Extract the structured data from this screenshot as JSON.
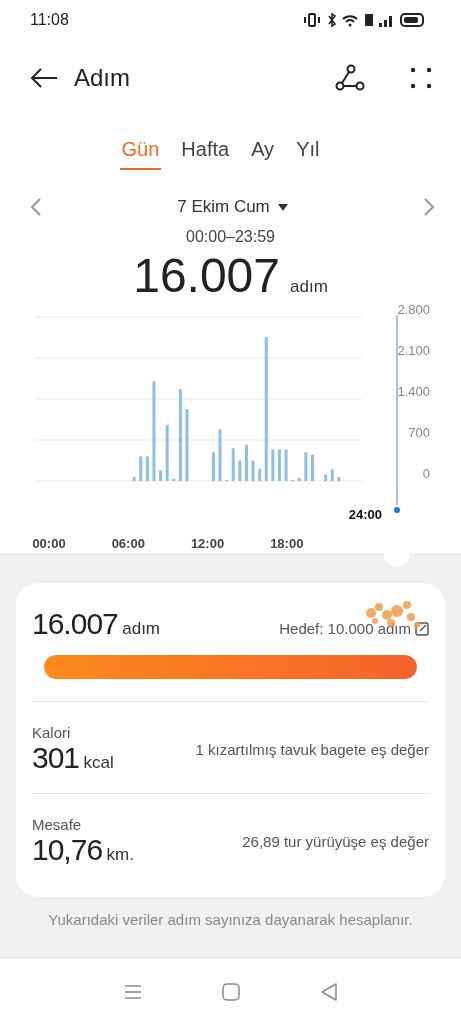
{
  "status_bar": {
    "time": "11:08"
  },
  "header": {
    "title": "Adım"
  },
  "tabs": [
    {
      "label": "Gün",
      "selected": true
    },
    {
      "label": "Hafta",
      "selected": false
    },
    {
      "label": "Ay",
      "selected": false
    },
    {
      "label": "Yıl",
      "selected": false
    }
  ],
  "date_nav": {
    "date": "7 Ekim Cum",
    "range": "00:00–23:59"
  },
  "total": {
    "value": "16.007",
    "unit": "adım"
  },
  "chart": {
    "cursor_label": "24:00",
    "chart_data": {
      "type": "bar",
      "xlim": [
        0,
        24
      ],
      "ylim": [
        0,
        2800
      ],
      "grid": true,
      "x": [
        6.75,
        7.25,
        7.75,
        8.25,
        8.75,
        9.25,
        9.75,
        10.25,
        10.75,
        12.75,
        13.25,
        13.75,
        14.25,
        14.75,
        15.25,
        15.75,
        16.25,
        16.75,
        17.25,
        17.75,
        18.25,
        18.75,
        19.25,
        19.75,
        20.25,
        21.25,
        21.75,
        22.25
      ],
      "xticks": [
        {
          "value": 0,
          "label": "00:00"
        },
        {
          "value": 6,
          "label": "06:00"
        },
        {
          "value": 12,
          "label": "12:00"
        },
        {
          "value": 18,
          "label": "18:00"
        }
      ],
      "yticks": [
        {
          "value": 0,
          "label": "0"
        },
        {
          "value": 700,
          "label": "700"
        },
        {
          "value": 1400,
          "label": "1.400"
        },
        {
          "value": 2100,
          "label": "2.100"
        },
        {
          "value": 2800,
          "label": "2.800"
        }
      ],
      "series": [
        {
          "color": "#8cbfe8",
          "values": [
            70,
            420,
            420,
            1700,
            180,
            960,
            40,
            1570,
            1230,
            490,
            880,
            20,
            560,
            350,
            620,
            350,
            210,
            2460,
            540,
            540,
            540,
            20,
            50,
            490,
            450,
            110,
            200,
            70
          ]
        }
      ]
    }
  },
  "summary": {
    "steps": {
      "value": "16.007",
      "unit": "adım"
    },
    "goal": "Hedef: 10.000 adım",
    "level": 1,
    "rows": [
      {
        "label": "Kalori",
        "value": "301",
        "unit": "kcal",
        "note": "1 kızartılmış tavuk bagete eş değer"
      },
      {
        "label": "Mesafe",
        "value": "10,76",
        "unit": "km.",
        "note": "26,89 tur yürüyüşe eş değer"
      }
    ]
  },
  "footnote": "Yukarıdaki veriler adım sayınıza dayanarak hesaplanır."
}
